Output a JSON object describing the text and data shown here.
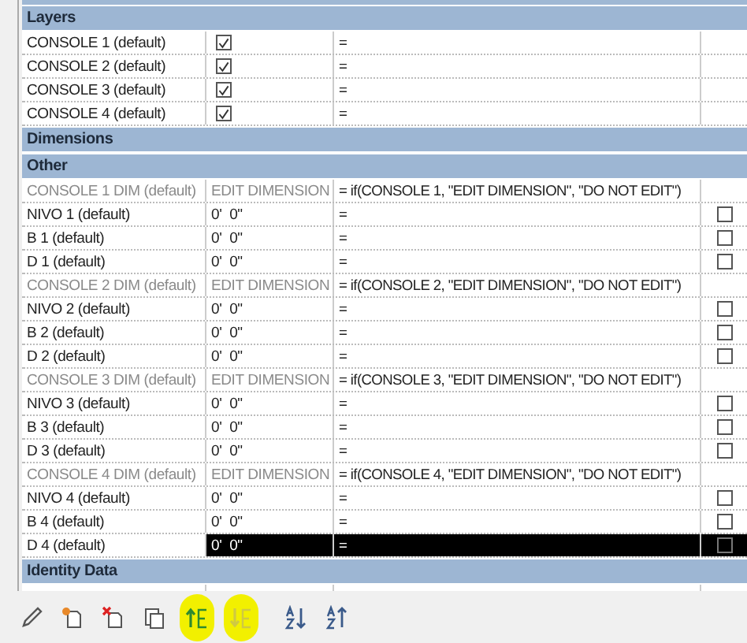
{
  "sections": [
    {
      "title": "Layers",
      "rows": [
        {
          "kind": "toggle",
          "name": "CONSOLE 1 (default)",
          "checked": true,
          "formula": "=",
          "selected": false
        },
        {
          "kind": "toggle",
          "name": "CONSOLE 2 (default)",
          "checked": true,
          "formula": "=",
          "selected": false
        },
        {
          "kind": "toggle",
          "name": "CONSOLE 3 (default)",
          "checked": true,
          "formula": "=",
          "selected": false
        },
        {
          "kind": "toggle",
          "name": "CONSOLE 4 (default)",
          "checked": true,
          "formula": "=",
          "selected": false
        }
      ]
    },
    {
      "title": "Dimensions"
    },
    {
      "title": "Other",
      "rows": [
        {
          "kind": "dim",
          "name": "CONSOLE 1 DIM (default)",
          "value": "EDIT DIMENSION",
          "formula": "= if(CONSOLE 1, \"EDIT DIMENSION\", \"DO NOT EDIT\")",
          "selected": false
        },
        {
          "kind": "length",
          "name": "NIVO 1 (default)",
          "value": "0'  0\"",
          "formula": "=",
          "locked": false,
          "selected": false
        },
        {
          "kind": "length",
          "name": "B 1 (default)",
          "value": "0'  0\"",
          "formula": "=",
          "locked": false,
          "selected": false
        },
        {
          "kind": "length",
          "name": "D 1 (default)",
          "value": "0'  0\"",
          "formula": "=",
          "locked": false,
          "selected": false
        },
        {
          "kind": "dim",
          "name": "CONSOLE 2 DIM (default)",
          "value": "EDIT DIMENSION",
          "formula": "= if(CONSOLE 2, \"EDIT DIMENSION\", \"DO NOT EDIT\")",
          "selected": false
        },
        {
          "kind": "length",
          "name": "NIVO 2 (default)",
          "value": "0'  0\"",
          "formula": "=",
          "locked": false,
          "selected": false
        },
        {
          "kind": "length",
          "name": "B 2 (default)",
          "value": "0'  0\"",
          "formula": "=",
          "locked": false,
          "selected": false
        },
        {
          "kind": "length",
          "name": "D 2 (default)",
          "value": "0'  0\"",
          "formula": "=",
          "locked": false,
          "selected": false
        },
        {
          "kind": "dim",
          "name": "CONSOLE 3 DIM (default)",
          "value": "EDIT DIMENSION",
          "formula": "= if(CONSOLE 3, \"EDIT DIMENSION\", \"DO NOT EDIT\")",
          "selected": false
        },
        {
          "kind": "length",
          "name": "NIVO 3 (default)",
          "value": "0'  0\"",
          "formula": "=",
          "locked": false,
          "selected": false
        },
        {
          "kind": "length",
          "name": "B 3 (default)",
          "value": "0'  0\"",
          "formula": "=",
          "locked": false,
          "selected": false
        },
        {
          "kind": "length",
          "name": "D 3 (default)",
          "value": "0'  0\"",
          "formula": "=",
          "locked": false,
          "selected": false
        },
        {
          "kind": "dim",
          "name": "CONSOLE 4 DIM (default)",
          "value": "EDIT DIMENSION",
          "formula": "= if(CONSOLE 4, \"EDIT DIMENSION\", \"DO NOT EDIT\")",
          "selected": false
        },
        {
          "kind": "length",
          "name": "NIVO 4 (default)",
          "value": "0'  0\"",
          "formula": "=",
          "locked": false,
          "selected": false
        },
        {
          "kind": "length",
          "name": "B 4 (default)",
          "value": "0'  0\"",
          "formula": "=",
          "locked": false,
          "selected": false
        },
        {
          "kind": "length",
          "name": "D 4 (default)",
          "value": "0'  0\"",
          "formula": "=",
          "locked": false,
          "selected": true
        }
      ]
    },
    {
      "title": "Identity Data"
    }
  ],
  "toolbar": [
    {
      "kind": "edit",
      "highlighted": false,
      "disabled": false
    },
    {
      "kind": "new",
      "highlighted": false,
      "disabled": false
    },
    {
      "kind": "delete",
      "highlighted": false,
      "disabled": false
    },
    {
      "kind": "duplicate",
      "highlighted": false,
      "disabled": false
    },
    {
      "kind": "move-up",
      "highlighted": true,
      "disabled": false
    },
    {
      "kind": "move-down",
      "highlighted": true,
      "disabled": true
    },
    {
      "kind": "sort-ascending",
      "highlighted": false,
      "disabled": false
    },
    {
      "kind": "sort-descending",
      "highlighted": false,
      "disabled": false
    }
  ]
}
